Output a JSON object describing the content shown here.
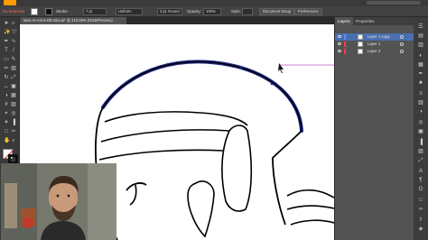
{
  "control_bar": {
    "selection_label": "No Selection",
    "stroke_label": "Stroke:",
    "stroke_weight": "7 pt",
    "profile": "Uniform",
    "brush": "3 pt. Round",
    "opacity_label": "Opacity:",
    "opacity_value": "100%",
    "style_label": "Style:",
    "document_setup": "Document Setup",
    "preferences": "Preferences"
  },
  "document_tab": {
    "title": "Man-At-Arms RB Inks.ai* @ 216.09% (RGB/Preview)"
  },
  "layers_panel": {
    "tabs": [
      "Layers",
      "Properties"
    ],
    "layers": [
      {
        "name": "Layer 1 copy",
        "selected": true,
        "color": "#5b8cff"
      },
      {
        "name": "Layer 1",
        "selected": false,
        "color": "#ff3b3b"
      },
      {
        "name": "Layer 2",
        "selected": false,
        "color": "#ff3b3b"
      }
    ]
  },
  "colors": {
    "selection_path": "#1e2a8a",
    "guide_line": "#c050c0",
    "panel_bg": "#535353",
    "app_bg": "#323232"
  }
}
